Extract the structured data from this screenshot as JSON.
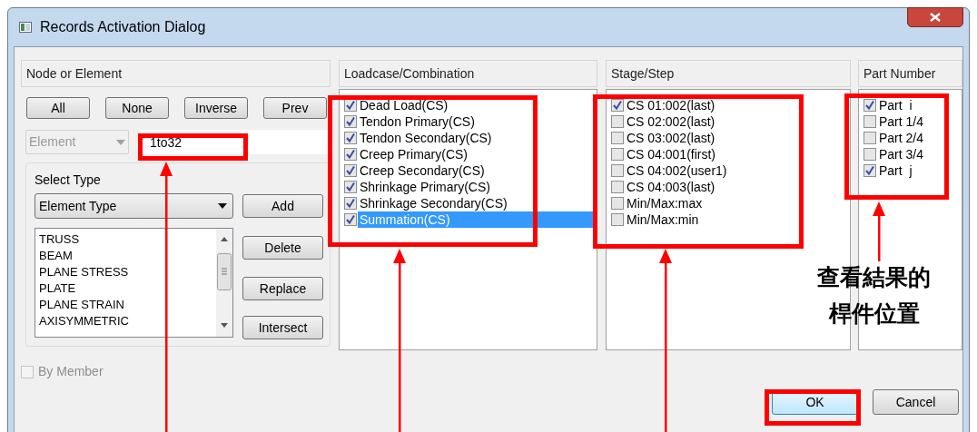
{
  "window": {
    "title": "Records Activation Dialog"
  },
  "node_or_element": {
    "title": "Node or Element",
    "buttons": [
      "All",
      "None",
      "Inverse",
      "Prev"
    ],
    "mode_combo": {
      "value": "Element",
      "disabled": true
    },
    "selection_field": {
      "value": "1to32"
    },
    "select_type": {
      "title": "Select Type",
      "combo": {
        "value": "Element Type"
      },
      "list": [
        "TRUSS",
        "BEAM",
        "PLANE STRESS",
        "PLATE",
        "PLANE STRAIN",
        "AXISYMMETRIC"
      ],
      "buttons": [
        "Add",
        "Delete",
        "Replace",
        "Intersect"
      ]
    },
    "by_member": {
      "label": "By Member",
      "checked": false,
      "disabled": true
    }
  },
  "loadcase": {
    "title": "Loadcase/Combination",
    "items": [
      {
        "label": "Dead Load(CS)",
        "checked": true,
        "selected": false
      },
      {
        "label": "Tendon Primary(CS)",
        "checked": true,
        "selected": false
      },
      {
        "label": "Tendon Secondary(CS)",
        "checked": true,
        "selected": false
      },
      {
        "label": "Creep Primary(CS)",
        "checked": true,
        "selected": false
      },
      {
        "label": "Creep Secondary(CS)",
        "checked": true,
        "selected": false
      },
      {
        "label": "Shrinkage Primary(CS)",
        "checked": true,
        "selected": false
      },
      {
        "label": "Shrinkage Secondary(CS)",
        "checked": true,
        "selected": false
      },
      {
        "label": "Summation(CS)",
        "checked": true,
        "selected": true
      }
    ]
  },
  "stage": {
    "title": "Stage/Step",
    "items": [
      {
        "label": "CS 01:002(last)",
        "checked": true
      },
      {
        "label": "CS 02:002(last)",
        "checked": false
      },
      {
        "label": "CS 03:002(last)",
        "checked": false
      },
      {
        "label": "CS 04:001(first)",
        "checked": false
      },
      {
        "label": "CS 04:002(user1)",
        "checked": false
      },
      {
        "label": "CS 04:003(last)",
        "checked": false
      },
      {
        "label": "Min/Max:max",
        "checked": false
      },
      {
        "label": "Min/Max:min",
        "checked": false
      }
    ]
  },
  "part": {
    "title": "Part Number",
    "items": [
      {
        "label": "Part  i",
        "checked": true
      },
      {
        "label": "Part 1/4",
        "checked": false
      },
      {
        "label": "Part 2/4",
        "checked": false
      },
      {
        "label": "Part 3/4",
        "checked": false
      },
      {
        "label": "Part  j",
        "checked": true
      }
    ]
  },
  "buttons": [
    {
      "label": "OK",
      "default": true
    },
    {
      "label": "Cancel",
      "default": false
    }
  ],
  "annotation": {
    "lines": [
      "查看結果的",
      "桿件位置"
    ]
  }
}
